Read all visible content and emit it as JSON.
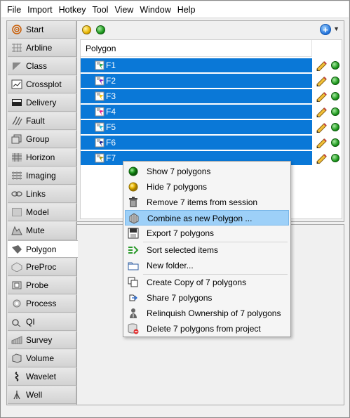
{
  "menubar": [
    "File",
    "Import",
    "Hotkey",
    "Tool",
    "View",
    "Window",
    "Help"
  ],
  "sidebar": {
    "items": [
      {
        "label": "Start",
        "icon": "target-icon"
      },
      {
        "label": "Arbline",
        "icon": "arbline-icon"
      },
      {
        "label": "Class",
        "icon": "class-icon"
      },
      {
        "label": "Crossplot",
        "icon": "crossplot-icon"
      },
      {
        "label": "Delivery",
        "icon": "delivery-icon"
      },
      {
        "label": "Fault",
        "icon": "fault-icon"
      },
      {
        "label": "Group",
        "icon": "group-icon"
      },
      {
        "label": "Horizon",
        "icon": "horizon-icon"
      },
      {
        "label": "Imaging",
        "icon": "imaging-icon"
      },
      {
        "label": "Links",
        "icon": "links-icon"
      },
      {
        "label": "Model",
        "icon": "model-icon"
      },
      {
        "label": "Mute",
        "icon": "mute-icon"
      },
      {
        "label": "Polygon",
        "icon": "polygon-icon",
        "active": true
      },
      {
        "label": "PreProc",
        "icon": "preproc-icon"
      },
      {
        "label": "Probe",
        "icon": "probe-icon"
      },
      {
        "label": "Process",
        "icon": "process-icon"
      },
      {
        "label": "QI",
        "icon": "qi-icon"
      },
      {
        "label": "Survey",
        "icon": "survey-icon"
      },
      {
        "label": "Volume",
        "icon": "volume-icon"
      },
      {
        "label": "Wavelet",
        "icon": "wavelet-icon"
      },
      {
        "label": "Well",
        "icon": "well-icon"
      }
    ]
  },
  "list": {
    "column_header": "Polygon",
    "rows": [
      {
        "name": "F1",
        "flag_color": "#19a34a"
      },
      {
        "name": "F2",
        "flag_color": "#7a1fc8"
      },
      {
        "name": "F3",
        "flag_color": "#f2c500"
      },
      {
        "name": "F4",
        "flag_color": "#e8198c"
      },
      {
        "name": "F5",
        "flag_color": "#19b8d8"
      },
      {
        "name": "F6",
        "flag_color": "#0a1a8c"
      },
      {
        "name": "F7",
        "flag_color": "#a89a10"
      }
    ]
  },
  "context_menu": {
    "items": [
      {
        "label": "Show 7 polygons",
        "icon": "green-dot-icon"
      },
      {
        "label": "Hide 7 polygons",
        "icon": "yellow-dot-icon"
      },
      {
        "label": "Remove 7 items from session",
        "icon": "trash-icon"
      },
      {
        "label": "Combine as new Polygon ...",
        "icon": "combine-icon",
        "highlighted": true
      },
      {
        "label": "Export 7 polygons",
        "icon": "export-icon"
      },
      {
        "label": "Sort selected items",
        "icon": "sort-icon"
      },
      {
        "label": "New folder...",
        "icon": "folder-icon"
      },
      {
        "label": "Create Copy of 7 polygons",
        "icon": "copy-icon"
      },
      {
        "label": "Share 7 polygons",
        "icon": "share-icon"
      },
      {
        "label": "Relinquish Ownership of 7 polygons",
        "icon": "relinquish-icon"
      },
      {
        "label": "Delete 7 polygons from project",
        "icon": "delete-db-icon"
      }
    ]
  },
  "colors": {
    "selection": "#0a78d7",
    "menu_highlight": "#9dd0f8"
  }
}
